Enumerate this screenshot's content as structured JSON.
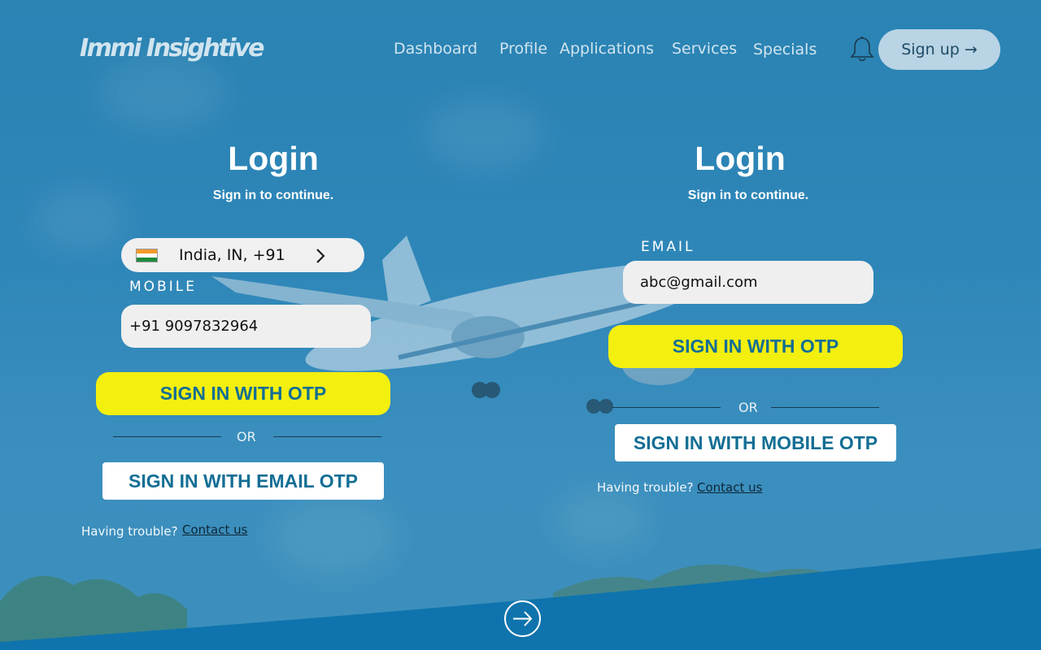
{
  "header": {
    "logo": "Immi Insightive",
    "nav": [
      "Dashboard",
      "Profile",
      "Applications",
      "Services",
      "Specials"
    ],
    "signup_label": "Sign up →"
  },
  "left_card": {
    "title": "Login",
    "subtitle": "Sign in to continue.",
    "country": "India, IN, +91",
    "mobile_label": "MOBILE",
    "mobile_value": "+91 9097832964",
    "primary_button": "SIGN IN WITH OTP",
    "or": "OR",
    "alt_button": "SIGN IN WITH EMAIL OTP",
    "trouble": "Having trouble?",
    "contact": "Contact us"
  },
  "right_card": {
    "title": "Login",
    "subtitle": "Sign in to continue.",
    "email_label": "EMAIL",
    "email_value": "abc@gmail.com",
    "primary_button": "SIGN IN WITH OTP",
    "or": "OR",
    "alt_button": "SIGN IN WITH MOBILE OTP",
    "trouble": "Having trouble?",
    "contact": "Contact us"
  },
  "colors": {
    "accent_yellow": "#f3ef0f",
    "button_text": "#136e94",
    "background": "#2e86b8"
  },
  "icons": {
    "bell": "bell-icon",
    "flag": "india-flag-icon",
    "chevron": "chevron-right-icon",
    "scroll": "arrow-right-circle-icon"
  }
}
